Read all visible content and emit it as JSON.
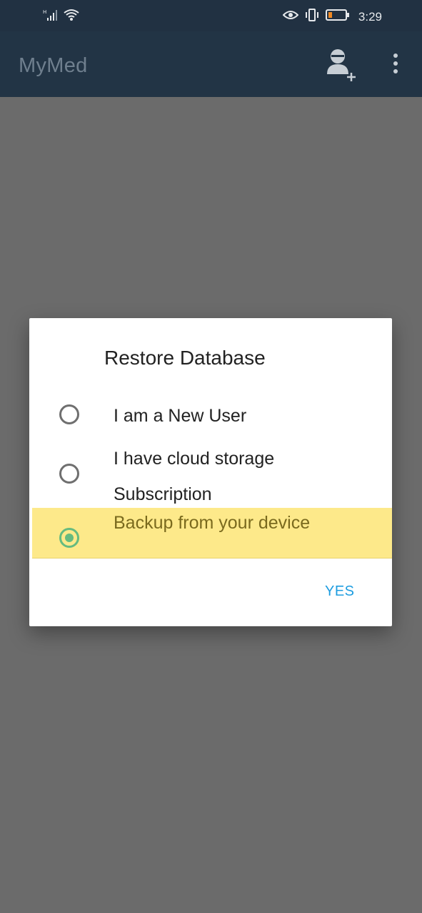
{
  "status_bar": {
    "time": "3:29",
    "icons": [
      "signal-icon",
      "wifi-icon",
      "eye-icon",
      "vibrate-icon",
      "battery-icon"
    ]
  },
  "app_bar": {
    "title": "MyMed",
    "actions": [
      "add-user-icon",
      "more-options-icon"
    ]
  },
  "dialog": {
    "title": "Restore Database",
    "options": [
      {
        "label": "I am a New User",
        "selected": false
      },
      {
        "label": "I have cloud storage Subscription",
        "selected": false
      },
      {
        "label": "Backup from your device",
        "selected": true
      }
    ],
    "confirm_label": "YES"
  },
  "colors": {
    "app_bar": "#223445",
    "scrim": "#6b6b6b",
    "radio_selected": "#66bb7f",
    "highlight": "#fde98a",
    "button_text": "#1e9de0"
  }
}
